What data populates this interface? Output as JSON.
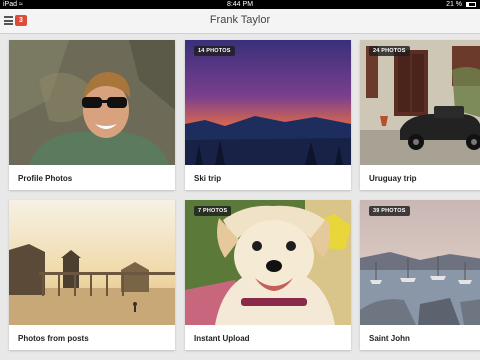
{
  "status_bar": {
    "device": "iPad",
    "time": "8:44 PM",
    "battery_text": "21 %",
    "battery_level": 0.21
  },
  "header": {
    "title": "Frank Taylor",
    "notification_count": "3"
  },
  "albums": [
    {
      "caption": "Profile Photos",
      "badge": ""
    },
    {
      "caption": "Ski trip",
      "badge": "14 PHOTOS"
    },
    {
      "caption": "Uruguay trip",
      "badge": "24 PHOTOS"
    },
    {
      "caption": "Photos from posts",
      "badge": ""
    },
    {
      "caption": "Instant Upload",
      "badge": "7 PHOTOS"
    },
    {
      "caption": "Saint John",
      "badge": "39 PHOTOS"
    }
  ]
}
